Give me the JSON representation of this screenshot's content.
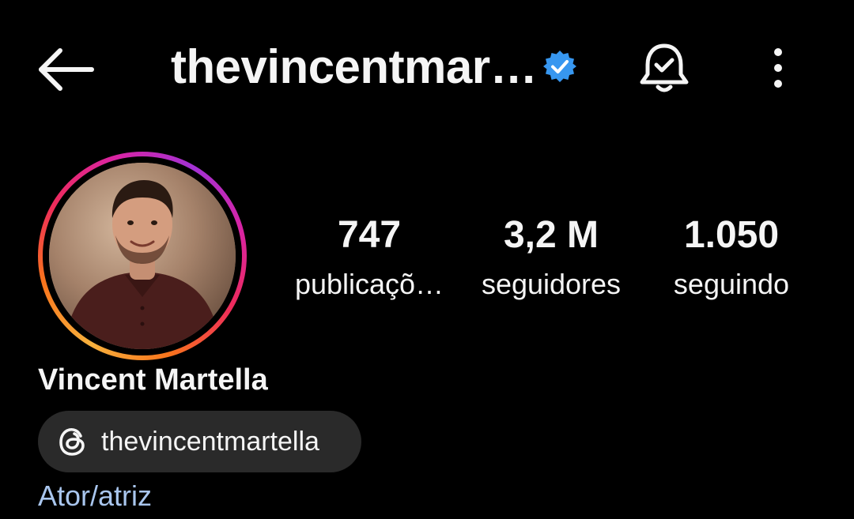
{
  "header": {
    "username": "thevincentmar…",
    "icons": {
      "back": "back-arrow-icon",
      "verified": "verified-badge-icon",
      "notifications": "bell-check-icon",
      "more": "more-vertical-icon"
    }
  },
  "profile": {
    "avatar": "profile-photo",
    "stats": [
      {
        "value": "747",
        "label": "publicaçõ…"
      },
      {
        "value": "3,2 M",
        "label": "seguidores"
      },
      {
        "value": "1.050",
        "label": "seguindo"
      }
    ],
    "full_name": "Vincent Martella",
    "threads": {
      "icon": "threads-icon",
      "handle": "thevincentmartella"
    },
    "category": "Ator/atriz"
  },
  "colors": {
    "background": "#000000",
    "text": "#f5f5f5",
    "verified_blue": "#3797f0",
    "category_link": "#a9c6ee",
    "chip_background": "#2a2a2a"
  }
}
